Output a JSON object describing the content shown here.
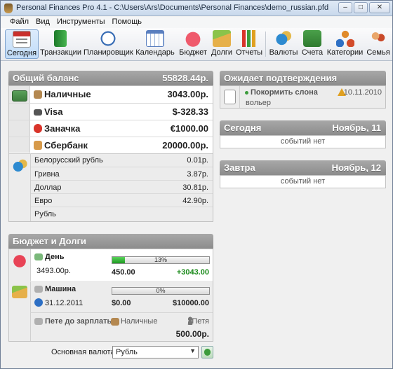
{
  "window": {
    "title": "Personal Finances Pro 4.1 - C:\\Users\\Ars\\Documents\\Personal Finances\\demo_russian.pfd",
    "controls": {
      "minimize": "–",
      "maximize": "□",
      "close": "✕"
    }
  },
  "menu": [
    "Файл",
    "Вид",
    "Инструменты",
    "Помощь"
  ],
  "toolbar": [
    {
      "label": "Сегодня",
      "icon": "calendar-today-icon",
      "color": "#c9302c",
      "active": true
    },
    {
      "label": "Транзакции",
      "icon": "book-icon",
      "color": "#2e9a3c"
    },
    {
      "label": "Планировщик",
      "icon": "clock-icon",
      "color": "#3b6fb6"
    },
    {
      "label": "Календарь",
      "icon": "calendar-icon",
      "color": "#5a7fbf"
    },
    {
      "label": "Бюджет",
      "icon": "piggy-bank-icon",
      "color": "#d9344a"
    },
    {
      "label": "Долги",
      "icon": "money-hand-icon",
      "color": "#d99a2b"
    },
    {
      "label": "Отчеты",
      "icon": "chart-icon",
      "color": "#e0a020"
    },
    {
      "label": "Валюты",
      "icon": "currency-exchange-icon",
      "color": "#2d8ad0"
    },
    {
      "label": "Счета",
      "icon": "wallet-icon",
      "color": "#3c8c3c"
    },
    {
      "label": "Категории",
      "icon": "categories-icon",
      "color": "#d24b2a"
    },
    {
      "label": "Семья",
      "icon": "family-icon",
      "color": "#c94a2a"
    }
  ],
  "balance": {
    "title": "Общий баланс",
    "total": "55828.44р.",
    "accounts": [
      {
        "name": "Наличные",
        "value": "3043.00р.",
        "icon": "cash-icon"
      },
      {
        "name": "Visa",
        "value": "$-328.33",
        "icon": "card-icon"
      },
      {
        "name": "Заначка",
        "value": "€1000.00",
        "icon": "alarm-clock-icon"
      },
      {
        "name": "Сбербанк",
        "value": "20000.00р.",
        "icon": "bank-icon"
      }
    ],
    "currencies": [
      {
        "name": "Белорусский рубль",
        "value": "0.01р."
      },
      {
        "name": "Гривна",
        "value": "3.87р."
      },
      {
        "name": "Доллар",
        "value": "30.81р."
      },
      {
        "name": "Евро",
        "value": "42.90р."
      },
      {
        "name": "Рубль",
        "value": ""
      }
    ]
  },
  "budget": {
    "title": "Бюджет и Долги",
    "items": [
      {
        "name": "День",
        "sub": "3493.00р.",
        "percent": 13,
        "percent_label": "13%",
        "left": "450.00",
        "right": "+3043.00"
      },
      {
        "name": "Машина",
        "sub": "31.12.2011",
        "percent": 0,
        "percent_label": "0%",
        "left": "$0.00",
        "right": "$10000.00"
      }
    ],
    "debt": {
      "name": "Пете до зарплаты",
      "account": "Наличные",
      "person": "Петя",
      "amount": "500.00р."
    }
  },
  "pending": {
    "title": "Ожидает подтверждения",
    "item": {
      "name": "Покормить слона",
      "sub": "вольер",
      "date": "10.11.2010"
    }
  },
  "today": {
    "title": "Сегодня",
    "date": "Ноябрь, 11",
    "empty": "событий нет"
  },
  "tomorrow": {
    "title": "Завтра",
    "date": "Ноябрь, 12",
    "empty": "событий нет"
  },
  "footer": {
    "currency_label": "Основная валюта",
    "currency_value": "Рубль"
  }
}
